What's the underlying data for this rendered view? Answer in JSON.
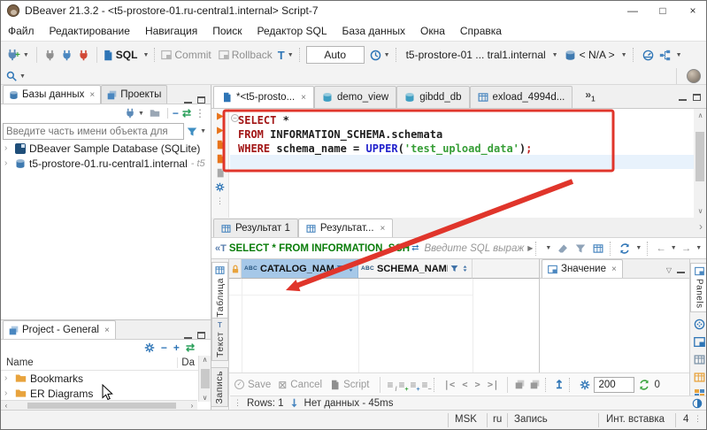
{
  "window": {
    "title": "DBeaver 21.3.2 - <t5-prostore-01.ru-central1.internal> Script-7"
  },
  "glyphs": {
    "dropdown": "▼",
    "close": "×",
    "minimize": "—",
    "maximize": "□",
    "chevron": "›",
    "overflow": "»",
    "dots": "⋮",
    "scroll_up": "∧",
    "scroll_down": "∨",
    "scroll_left": "‹",
    "scroll_right": "›",
    "nav_first": "|<",
    "nav_prev": "<",
    "nav_next": ">",
    "nav_last": ">|",
    "arrow_left": "←",
    "arrow_right": "→",
    "minus": "−",
    "plus": "+",
    "cancel_box": "⊠",
    "check": "✓",
    "export_up": "↥",
    "play": "▶",
    "filter_tag": "«T",
    "fold": "−",
    "caret_down": "▽",
    "rows": "≡",
    "txn": "T"
  },
  "menu": {
    "items": [
      "Файл",
      "Редактирование",
      "Навигация",
      "Поиск",
      "Редактор SQL",
      "База данных",
      "Окна",
      "Справка"
    ]
  },
  "toolbar": {
    "sql": "SQL",
    "commit": "Commit",
    "rollback": "Rollback",
    "auto": "Auto",
    "connection": "t5-prostore-01 ... tral1.internal",
    "schema": "< N/A >"
  },
  "explorer": {
    "tab_databases": "Базы данных",
    "tab_projects": "Проекты",
    "filter_placeholder": "Введите часть имени объекта для",
    "item1": "DBeaver Sample Database (SQLite)",
    "item2": "t5-prostore-01.ru-central1.internal",
    "item2_suffix": "- t5"
  },
  "projects": {
    "tab": "Project - General",
    "col_name": "Name",
    "col_date": "Da",
    "item1": "Bookmarks",
    "item2": "ER Diagrams"
  },
  "editor": {
    "tab1": "*<t5-prosto...",
    "tab2": "demo_view",
    "tab3": "gibdd_db",
    "tab4": "exload_4994d...",
    "overflow_count": "1"
  },
  "sql": {
    "l1_kw": "SELECT",
    "l1_rest": " *",
    "l2_kw": "FROM",
    "l2_rest": " INFORMATION_SCHEMA.schemata",
    "l3_kw": "WHERE",
    "l3_mid": " schema_name = ",
    "l3_fn": "UPPER",
    "l3_open": "(",
    "l3_str": "'test_upload_data'",
    "l3_close": ")",
    "l3_semi": ";"
  },
  "results": {
    "tab1": "Результат 1",
    "tab2": "Результат...",
    "filter_text": "SELECT * FROM INFORMATION_SCH",
    "filter_placeholder": "Введите SQL выраж",
    "abc": "ABC",
    "col1": "CATALOG_NAME",
    "col2": "SCHEMA_NAME",
    "value_tab": "Значение",
    "panels": "Panels",
    "side_table": "Таблица",
    "side_text": "Текст",
    "side_record": "Запись",
    "save": "Save",
    "cancel": "Cancel",
    "script": "Script",
    "fetch_size": "200",
    "refresh_count": "0",
    "rows": "Rows: 1",
    "message": "Нет данных - 45ms"
  },
  "statusbar": {
    "tz": "MSK",
    "lang": "ru",
    "mode": "Запись",
    "insert": "Инт. вставка",
    "caret_line": "4"
  },
  "colors": {
    "annotation_red": "#e0352b",
    "header_selected": "#a6c8e8",
    "keyword": "#a21616",
    "function_blue": "#2222cc",
    "string_green": "#379e37",
    "accent_blue": "#2e75b6",
    "run_orange": "#e8731a"
  }
}
